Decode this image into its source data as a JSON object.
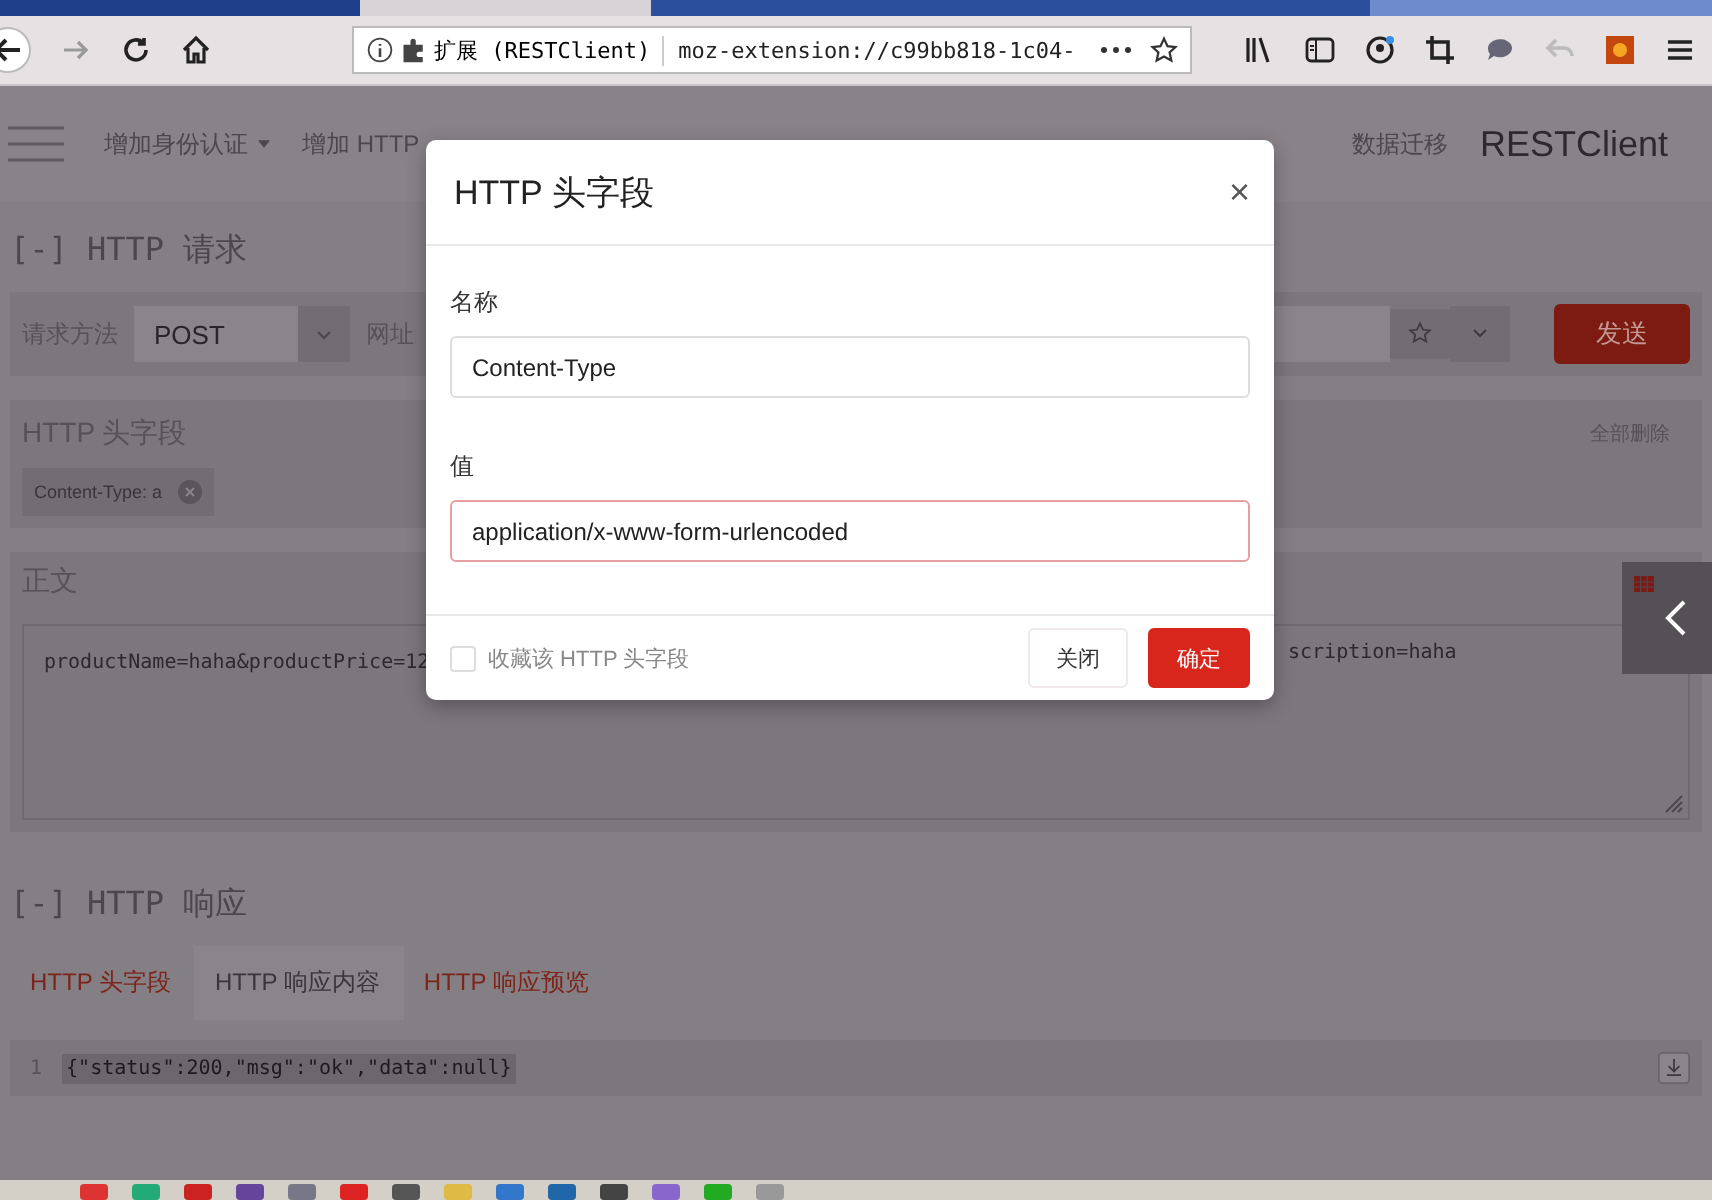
{
  "browser": {
    "site_label": "扩展 (RESTClient)",
    "url": "moz-extension://c99bb818-1c04-"
  },
  "nav": {
    "items": [
      {
        "label": "增加身份认证",
        "dropdown": true
      },
      {
        "label": "增加 HTTP",
        "dropdown": false
      }
    ],
    "right_items": [
      {
        "label": "数据迁移"
      }
    ],
    "brand": "RESTClient"
  },
  "request": {
    "title": "[-] HTTP 请求",
    "method_label": "请求方法",
    "method": "POST",
    "url_label": "网址",
    "send": "发送",
    "headers_title": "HTTP 头字段",
    "header_chips": [
      "Content-Type: a"
    ],
    "delete_all": "全部删除",
    "body_title": "正文",
    "body_left": "productName=haha&productPrice=12",
    "body_right": "scription=haha"
  },
  "response": {
    "title": "[-] HTTP 响应",
    "tabs": [
      {
        "label": "HTTP 头字段",
        "selected": false
      },
      {
        "label": "HTTP 响应内容",
        "selected": true
      },
      {
        "label": "HTTP 响应预览",
        "selected": false
      }
    ],
    "lines": [
      {
        "number": "1",
        "code": "{\"status\":200,\"msg\":\"ok\",\"data\":null}"
      }
    ]
  },
  "modal": {
    "title": "HTTP 头字段",
    "close": "×",
    "name_label": "名称",
    "name_value": "Content-Type",
    "value_label": "值",
    "value_value": "application/x-www-form-urlencoded",
    "value_focused": true,
    "favorite_label": "收藏该 HTTP 头字段",
    "favorite_checked": false,
    "buttons": [
      {
        "label": "关闭",
        "kind": "secondary"
      },
      {
        "label": "确定",
        "kind": "primary"
      }
    ]
  }
}
